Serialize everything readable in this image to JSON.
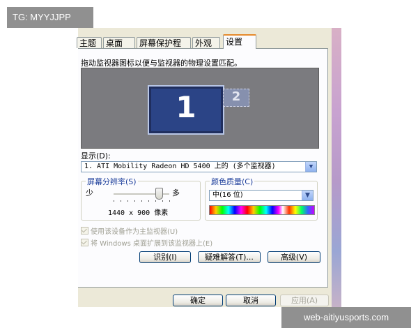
{
  "watermark": {
    "tag": "TG: MYYJJPP",
    "site": "web-aitiyusports.com"
  },
  "tabs": [
    {
      "label": "主题",
      "active": false
    },
    {
      "label": "桌面",
      "active": false
    },
    {
      "label": "屏幕保护程序",
      "active": false
    },
    {
      "label": "外观",
      "active": false
    },
    {
      "label": "设置",
      "active": true
    }
  ],
  "settings": {
    "instruction": "拖动监视器图标以便与监视器的物理设置匹配。",
    "monitors": {
      "primary": "1",
      "secondary": "2"
    },
    "display_label": "显示(D):",
    "display_value": "1. ATI Mobility Radeon HD 5400 上的 (多个监视器)",
    "resolution": {
      "title": "屏幕分辨率(S)",
      "less": "少",
      "more": "多",
      "value": "1440 x 900 像素",
      "slider_level": 0.8
    },
    "color_quality": {
      "title": "颜色质量(C)",
      "value": "中(16 位)"
    },
    "checkbox_primary": "使用该设备作为主监视器(U)",
    "checkbox_extend": "将 Windows 桌面扩展到该监视器上(E)",
    "buttons": {
      "identify": "识别(I)",
      "troubleshoot": "疑难解答(T)...",
      "advanced": "高级(V)"
    }
  },
  "footer_buttons": {
    "ok": "确定",
    "cancel": "取消",
    "apply": "应用(A)"
  },
  "colors": {
    "monitor_primary": "#2b4486",
    "accent_tab": "#e68b2c",
    "group_title": "#1c3e9b"
  }
}
